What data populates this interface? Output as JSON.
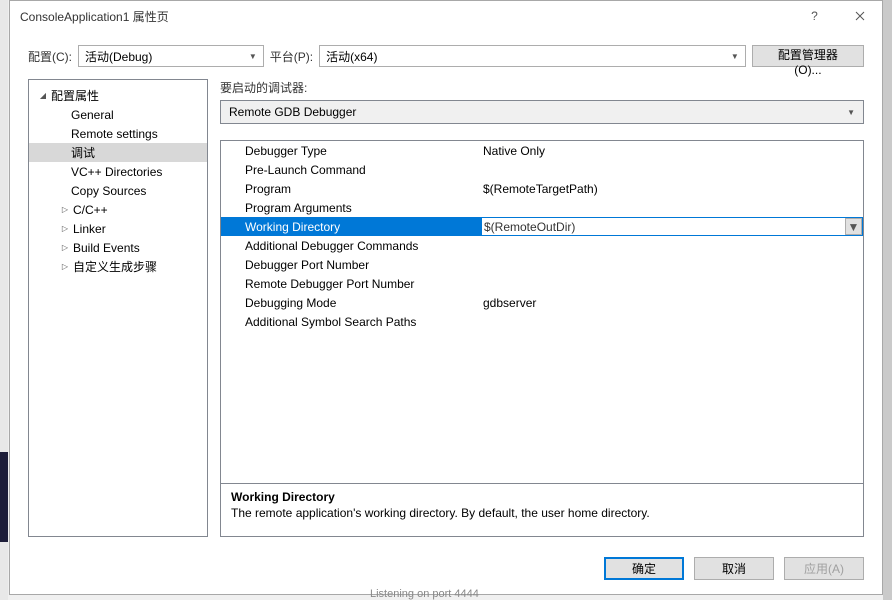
{
  "titlebar": {
    "title": "ConsoleApplication1 属性页"
  },
  "toprow": {
    "config_label": "配置(C):",
    "config_value": "活动(Debug)",
    "platform_label": "平台(P):",
    "platform_value": "活动(x64)",
    "config_manager": "配置管理器(O)..."
  },
  "tree": {
    "root": "配置属性",
    "items": [
      {
        "label": "General",
        "type": "child"
      },
      {
        "label": "Remote settings",
        "type": "child"
      },
      {
        "label": "调试",
        "type": "child",
        "selected": true
      },
      {
        "label": "VC++ Directories",
        "type": "child"
      },
      {
        "label": "Copy Sources",
        "type": "child"
      },
      {
        "label": "C/C++",
        "type": "subparent"
      },
      {
        "label": "Linker",
        "type": "subparent"
      },
      {
        "label": "Build Events",
        "type": "subparent"
      },
      {
        "label": "自定义生成步骤",
        "type": "subparent"
      }
    ]
  },
  "right": {
    "launch_label": "要启动的调试器:",
    "debugger_selection": "Remote GDB Debugger"
  },
  "props": [
    {
      "key": "Debugger Type",
      "val": "Native Only"
    },
    {
      "key": "Pre-Launch Command",
      "val": ""
    },
    {
      "key": "Program",
      "val": "$(RemoteTargetPath)"
    },
    {
      "key": "Program Arguments",
      "val": ""
    },
    {
      "key": "Working Directory",
      "val": "$(RemoteOutDir)",
      "selected": true
    },
    {
      "key": "Additional Debugger Commands",
      "val": ""
    },
    {
      "key": "Debugger Port Number",
      "val": ""
    },
    {
      "key": "Remote Debugger Port Number",
      "val": ""
    },
    {
      "key": "Debugging Mode",
      "val": "gdbserver"
    },
    {
      "key": "Additional Symbol Search Paths",
      "val": ""
    }
  ],
  "description": {
    "title": "Working Directory",
    "body": "The remote application's working directory. By default, the user home directory."
  },
  "footer": {
    "ok": "确定",
    "cancel": "取消",
    "apply": "应用(A)"
  },
  "status": "Listening on port 4444"
}
